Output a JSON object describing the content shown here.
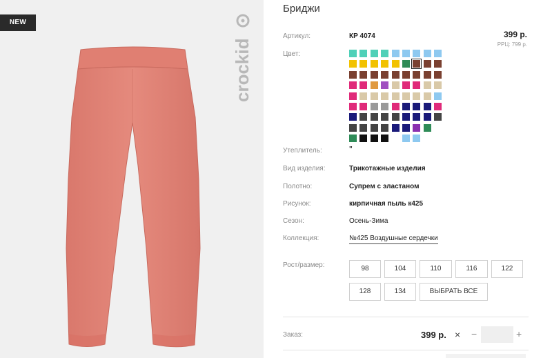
{
  "photo": {
    "badge": "NEW",
    "brand": "crockid"
  },
  "product": {
    "title": "Бриджи",
    "article_label": "Артикул:",
    "article_value": "КР 4074",
    "price": "399 р.",
    "rrp": "РРЦ: 799 р.",
    "color_label": "Цвет:",
    "insulation_label": "Утеплитель:",
    "insulation_value": "\"",
    "kind_label": "Вид изделия:",
    "kind_value": "Трикотажные изделия",
    "fabric_label": "Полотно:",
    "fabric_value": "Супрем с эластаном",
    "pattern_label": "Рисунок:",
    "pattern_value": "кирпичная пыль к425",
    "season_label": "Сезон:",
    "season_value": "Осень-Зима",
    "collection_label": "Коллекция:",
    "collection_value": "№425 Воздушные сердечки"
  },
  "swatch_colors": [
    [
      "#4fd0b8",
      "#4fd0b8",
      "#4fd0b8",
      "#4fd0b8",
      "#8ec9f0",
      "#8ec9f0",
      "#8ec9f0",
      "#8ec9f0",
      "#8ec9f0"
    ],
    [
      "#f2c200",
      "#f2c200",
      "#f2c200",
      "#f2c200",
      "#f2c200",
      "#2e8b57",
      "#7a4030",
      "#7a4030",
      "#7a4030"
    ],
    [
      "#7a4030",
      "#7a4030",
      "#7a4030",
      "#7a4030",
      "#7a4030",
      "#7a4030",
      "#7a4030",
      "#7a4030",
      "#7a4030"
    ],
    [
      "#e02a7a",
      "#e02a7a",
      "#e09a40",
      "#a050c0",
      "#d9c9a8",
      "#e02a7a",
      "#e02a7a",
      "#d9c9a8",
      "#d9c9a8"
    ],
    [
      "#e02a7a",
      "#d9c9a8",
      "#d9c9a8",
      "#d9c9a8",
      "#d9c9a8",
      "#d9c9a8",
      "#d9c9a8",
      "#d9c9a8",
      "#8ec9f0"
    ],
    [
      "#e02a7a",
      "#e02a7a",
      "#9a9a9a",
      "#9a9a9a",
      "#e02a7a",
      "#1a1a7a",
      "#1a1a7a",
      "#1a1a7a",
      "#e02a7a"
    ],
    [
      "#1a1a7a",
      "#444444",
      "#444444",
      "#444444",
      "#444444",
      "#1a1a7a",
      "#1a1a7a",
      "#1a1a7a",
      "#444444"
    ],
    [
      "#444444",
      "#444444",
      "#444444",
      "#444444",
      "#1a1a7a",
      "#1a1a7a",
      "#8a30b0",
      "#2e8b57",
      ""
    ],
    [
      "#2e8b57",
      "#111111",
      "#111111",
      "#111111",
      "",
      "#8ec9f0",
      "#8ec9f0",
      "",
      ""
    ]
  ],
  "selected_swatch": "row 1 col 6",
  "sizes": {
    "label": "Рост/размер:",
    "options": [
      "98",
      "104",
      "110",
      "116",
      "122",
      "128",
      "134"
    ],
    "select_all": "ВЫБРАТЬ ВСЕ"
  },
  "order": {
    "label": "Заказ:",
    "price": "399 р.",
    "times": "×",
    "minus": "−",
    "plus": "+",
    "qty": ""
  }
}
